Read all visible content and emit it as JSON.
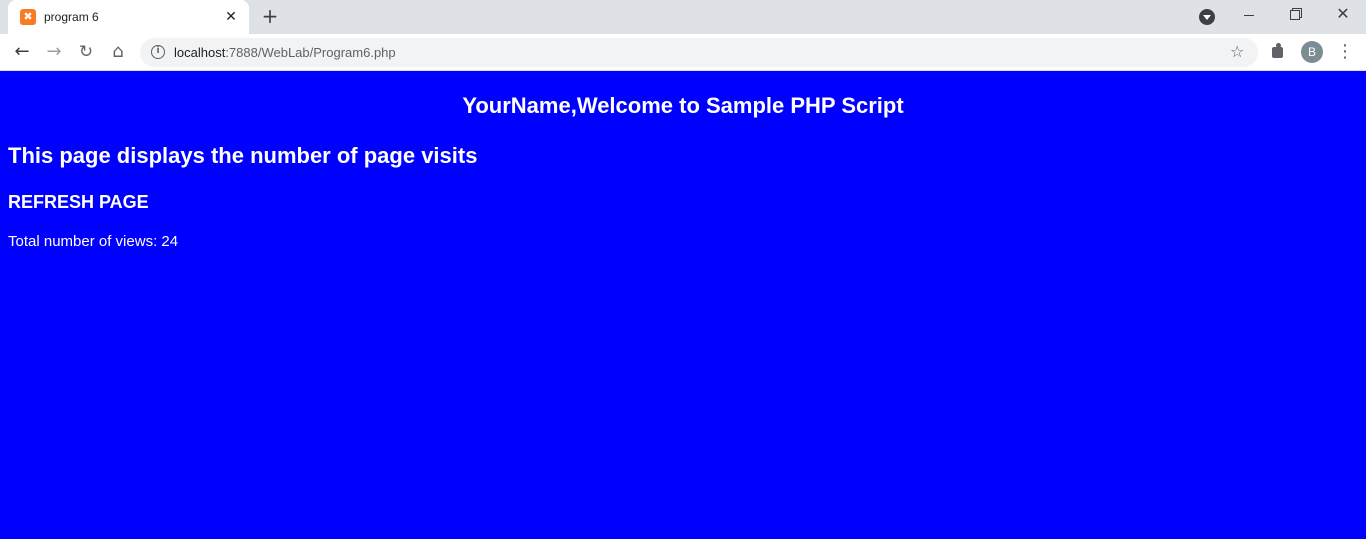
{
  "browser": {
    "tab_title": "program 6",
    "url_host": "localhost",
    "url_path": ":7888/WebLab/Program6.php",
    "profile_initial": "B",
    "new_tab_glyph": "+",
    "close_glyph": "✕",
    "favicon_glyph": "✖"
  },
  "icons": {
    "back": "arrow-left-icon",
    "forward": "arrow-right-icon",
    "reload": "reload-icon",
    "home": "home-icon",
    "info": "info-icon",
    "star": "star-icon",
    "extensions": "puzzle-icon",
    "menu": "kebab-menu-icon"
  },
  "page": {
    "background_color": "#0000ff",
    "heading": "YourName,Welcome to Sample PHP Script",
    "subheading": "This page displays the number of page visits",
    "refresh_label": "REFRESH PAGE",
    "views_label": "Total number of views: 24"
  }
}
